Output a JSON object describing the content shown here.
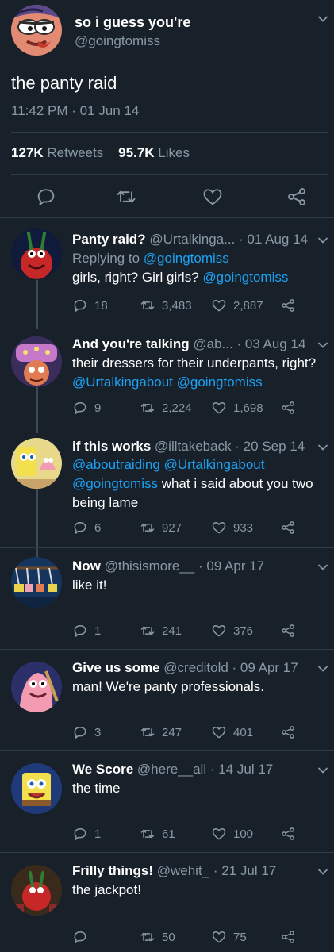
{
  "main_tweet": {
    "name": "so i guess you're",
    "handle": "@goingtomiss",
    "text": "the panty raid",
    "timestamp": "11:42 PM · 01 Jun 14",
    "retweets_count": "127K",
    "retweets_label": "Retweets",
    "likes_count": "95.7K",
    "likes_label": "Likes"
  },
  "replies": [
    {
      "name": "Panty raid?",
      "handle": "@Urtalkinga...",
      "date": "· 01 Aug 14",
      "replying_prefix": "Replying to",
      "replying_to": "@goingtomiss",
      "text": "girls, right? Girl girls?",
      "mention": "@goingtomiss",
      "replies": "18",
      "retweets": "3,483",
      "likes": "2,887"
    },
    {
      "name": "And you're talking",
      "handle": "@ab...",
      "date": "· 03 Aug 14",
      "text": "their dressers for their underpants, right?",
      "mention1": "@Urtalkingabout",
      "mention2": "@goingtomiss",
      "replies": "9",
      "retweets": "2,224",
      "likes": "1,698"
    },
    {
      "name": "if this works",
      "handle": "@illtakeback",
      "date": "· 20 Sep 14",
      "mention1": "@aboutraiding",
      "mention2": "@Urtalkingabout",
      "mention3": "@goingtomiss",
      "text_a": "what i said about you two",
      "text_b": "being lame",
      "replies": "6",
      "retweets": "927",
      "likes": "933"
    },
    {
      "name": "Now",
      "handle": "@thisismore__",
      "date": "· 09 Apr 17",
      "text": "like it!",
      "replies": "1",
      "retweets": "241",
      "likes": "376"
    },
    {
      "name": "Give us some",
      "handle": "@creditold",
      "date": "· 09 Apr 17",
      "text": "man! We're panty professionals.",
      "replies": "3",
      "retweets": "247",
      "likes": "401"
    },
    {
      "name": "We Score",
      "handle": "@here__all",
      "date": "· 14 Jul 17",
      "text": "the time",
      "replies": "1",
      "retweets": "61",
      "likes": "100"
    },
    {
      "name": "Frilly things!",
      "handle": "@wehit_",
      "date": "· 21 Jul 17",
      "text": "the jackpot!",
      "replies": "",
      "retweets": "50",
      "likes": "75"
    }
  ],
  "icons": {
    "reply": "reply-icon",
    "retweet": "retweet-icon",
    "like": "heart-icon",
    "share": "share-icon",
    "more": "chevron-down-icon"
  },
  "colors": {
    "background": "#18202a",
    "muted": "#8899a6",
    "accent": "#1da1f2",
    "divider": "#2f3d4a"
  }
}
